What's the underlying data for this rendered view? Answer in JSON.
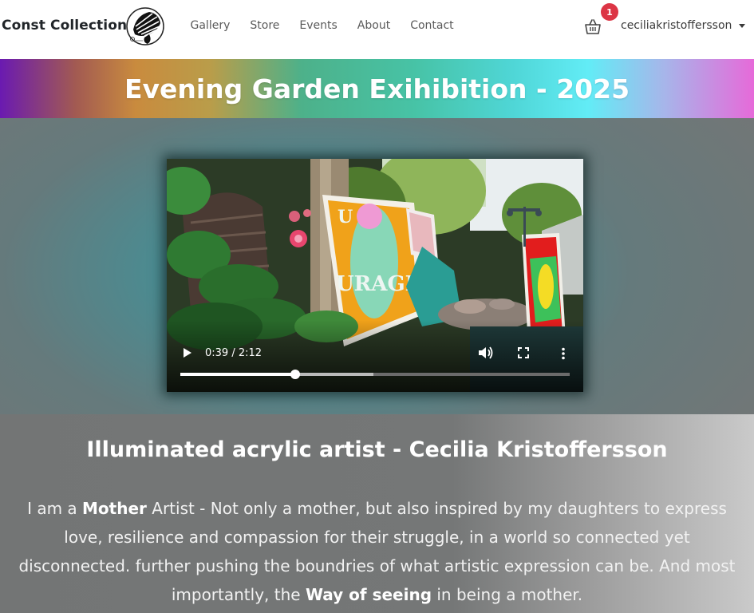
{
  "navbar": {
    "brand": "Const Collection",
    "logo_icon": "zebra-sketch-logo",
    "links": [
      "Gallery",
      "Store",
      "Events",
      "About",
      "Contact"
    ],
    "cart": {
      "icon": "basket-icon",
      "count": "1",
      "badge_color": "#dc3545"
    },
    "user": "ceciliakristoffersson"
  },
  "banner": {
    "title": "Evening Garden Exihibition - 2025"
  },
  "video": {
    "current_time": "0:39",
    "duration": "2:12",
    "time_display": "0:39 / 2:12",
    "progress_fraction": 0.295,
    "buffered_fraction": 0.495,
    "controls": [
      "play-icon",
      "volume-icon",
      "fullscreen-icon",
      "more-options-icon"
    ]
  },
  "about": {
    "heading": "Illuminated acrylic artist - Cecilia Kristoffersson",
    "bio_part1": "I am a ",
    "bio_bold1": "Mother",
    "bio_part2": " Artist - Not only a mother, but also inspired by my daughters to express love, resilience and compassion for their struggle, in a world so connected yet disconnected. further pushing the boundries of what artistic expression can be. And most importantly, the ",
    "bio_bold2": "Way of seeing",
    "bio_part3": " in being a mother."
  }
}
